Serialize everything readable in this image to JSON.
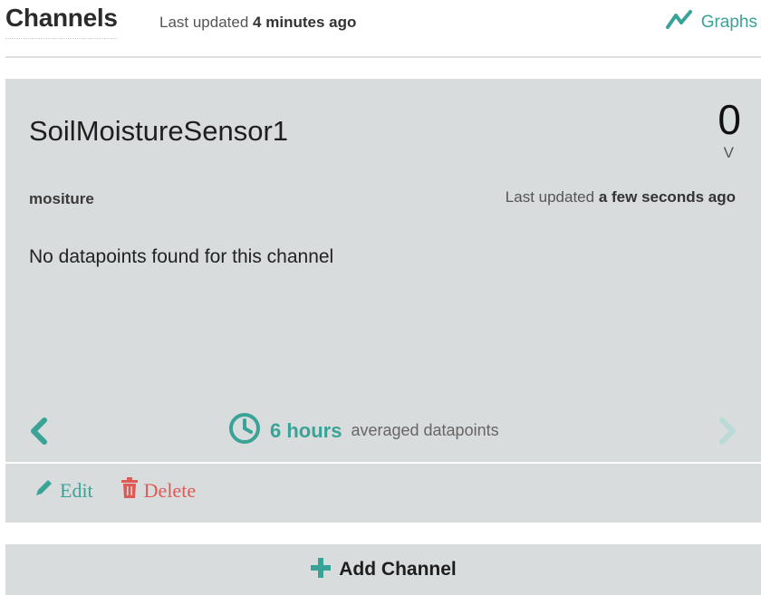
{
  "header": {
    "title": "Channels",
    "updated_prefix": "Last updated",
    "updated_time": "4 minutes ago",
    "graphs_label": "Graphs"
  },
  "channel": {
    "name": "SoilMoistureSensor1",
    "value": "0",
    "unit": "V",
    "field": "mositure",
    "updated_prefix": "Last updated",
    "updated_time": "a few seconds ago",
    "empty_message": "No datapoints found for this channel",
    "range_value": "6 hours",
    "range_label": "averaged datapoints",
    "edit_label": "Edit",
    "delete_label": "Delete"
  },
  "add_channel_label": "Add Channel",
  "colors": {
    "accent": "#3aa397",
    "danger": "#e05a55",
    "card_bg": "#d9dcdc"
  }
}
